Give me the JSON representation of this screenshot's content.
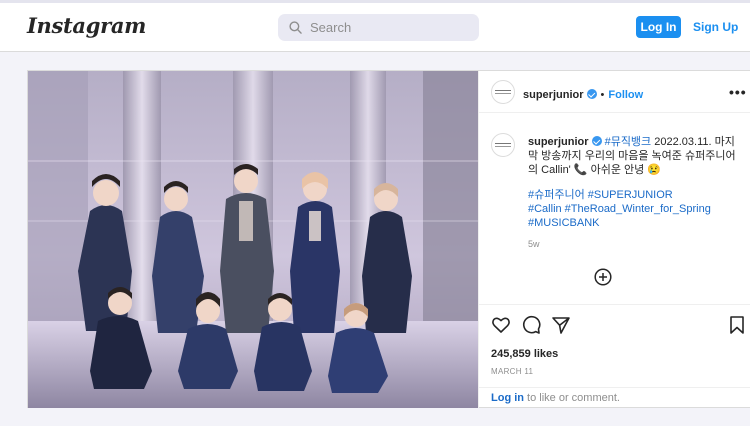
{
  "header": {
    "logo": "Instagram",
    "search_placeholder": "Search",
    "login_label": "Log In",
    "signup_label": "Sign Up"
  },
  "post": {
    "username": "superjunior",
    "follow_label": "Follow",
    "more_label": "•••",
    "caption_username": "superjunior",
    "caption_hashtag_first": "#뮤직뱅크",
    "caption_text": "2022.03.11. 마지막 방송까지 우리의 마음을 녹여준 슈퍼주니어의 Callin' 📞 아쉬운 안녕 😢",
    "hashtags_line1": "#슈퍼주니어 #SUPERJUNIOR",
    "hashtags_line2": "#Callin #TheRoad_Winter_for_Spring",
    "hashtags_line3": "#MUSICBANK",
    "age": "5w",
    "likes": "245,859 likes",
    "date": "MARCH 11",
    "login_link": "Log in",
    "login_suffix": " to like or comment."
  },
  "colors": {
    "accent": "#1b8ff0",
    "hashtag": "#1b6bc8",
    "verified": "#3897f0"
  },
  "icons": [
    "search-icon",
    "verified-icon",
    "more-icon",
    "add-comment-icon",
    "heart-icon",
    "comment-icon",
    "share-icon",
    "bookmark-icon"
  ]
}
